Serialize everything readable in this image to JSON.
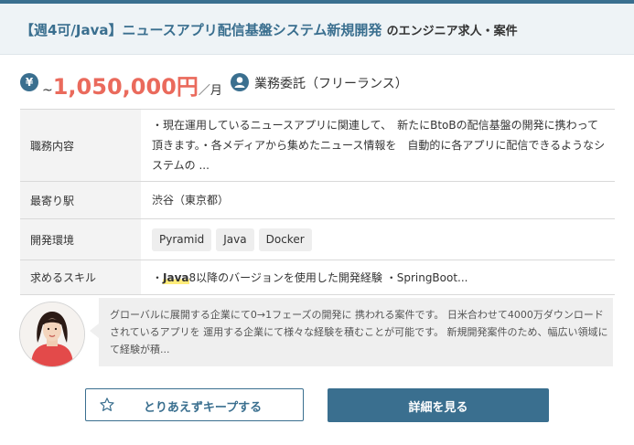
{
  "header": {
    "title": "【週4可/Java】ニュースアプリ配信基盤システム新規開発",
    "suffix": "のエンジニア求人・案件"
  },
  "salary": {
    "icon": "yen-icon",
    "prefix": "~",
    "amount": "1,050,000円",
    "per": "／月"
  },
  "contract": {
    "icon": "person-icon",
    "label": "業務委託（フリーランス）"
  },
  "details": {
    "job_label": "職務内容",
    "job_value": "・現在運用しているニュースアプリに関連して、　新たにBtoBの配信基盤の開発に携わって頂きます。・各メディアから集めたニュース情報を　自動的に各アプリに配信できるようなシステムの ...",
    "station_label": "最寄り駅",
    "station_value": "渋谷（東京都）",
    "env_label": "開発環境",
    "env_tags": [
      "Pyramid",
      "Java",
      "Docker"
    ],
    "skill_label": "求めるスキル",
    "skill_prefix": "・",
    "skill_highlight": "Java",
    "skill_rest": "8以降のバージョンを使用した開発経験 ・SpringBoot..."
  },
  "comment": {
    "text": "グローバルに展開する企業にて0→1フェーズの開発に 携われる案件です。 日米合わせて4000万ダウンロードされているアプリを 運用する企業にて様々な経験を積むことが可能です。 新規開発案件のため、幅広い領域にて経験が積..."
  },
  "buttons": {
    "keep_label": "とりあえずキープする",
    "detail_label": "詳細を見る"
  },
  "colors": {
    "accent": "#3a6f8f",
    "price": "#ea6a5c",
    "highlight": "#ffec7a"
  }
}
